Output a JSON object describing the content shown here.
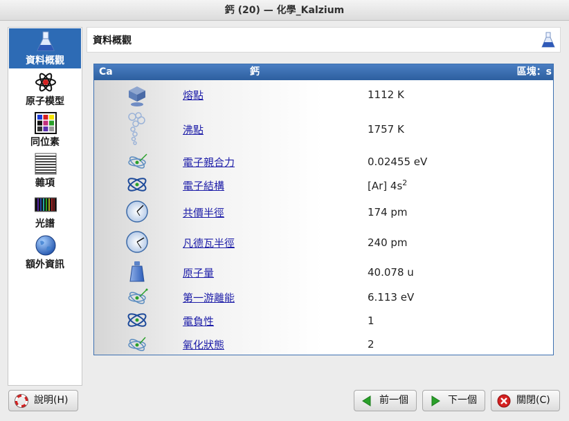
{
  "window": {
    "title": "鈣 (20)  — 化學_Kalzium"
  },
  "sidebar": {
    "items": [
      {
        "label": "資料概觀",
        "icon": "flask-icon",
        "active": true
      },
      {
        "label": "原子模型",
        "icon": "atom-icon",
        "active": false
      },
      {
        "label": "同位素",
        "icon": "isotope-grid-icon",
        "active": false
      },
      {
        "label": "雜項",
        "icon": "misc-lines-icon",
        "active": false
      },
      {
        "label": "光譜",
        "icon": "spectrum-icon",
        "active": false
      },
      {
        "label": "額外資訊",
        "icon": "globe-icon",
        "active": false
      }
    ]
  },
  "header": {
    "title": "資料概觀"
  },
  "panel": {
    "symbol": "Ca",
    "name": "鈣",
    "block": "區塊：s",
    "rows": [
      {
        "label": "熔點",
        "value": "1112 K",
        "icon": "melting-point-icon"
      },
      {
        "label": "沸點",
        "value": "1757 K",
        "icon": "boiling-point-icon"
      },
      {
        "label": "電子親合力",
        "value": "0.02455 eV",
        "icon": "electron-affinity-icon"
      },
      {
        "label": "電子結構",
        "value": "[Ar] 4s",
        "value_sup": "2",
        "icon": "electron-configuration-icon"
      },
      {
        "label": "共價半徑",
        "value": "174 pm",
        "icon": "covalent-radius-icon"
      },
      {
        "label": "凡德瓦半徑",
        "value": "240 pm",
        "icon": "van-der-waals-radius-icon"
      },
      {
        "label": "原子量",
        "value": "40.078 u",
        "icon": "atomic-mass-icon"
      },
      {
        "label": "第一游離能",
        "value": "6.113 eV",
        "icon": "ionization-energy-icon"
      },
      {
        "label": "電負性",
        "value": "1",
        "icon": "electronegativity-icon"
      },
      {
        "label": "氧化狀態",
        "value": "2",
        "icon": "oxidation-states-icon"
      }
    ]
  },
  "buttons": {
    "help": "說明(H)",
    "prev": "前一個",
    "next": "下一個",
    "close": "關閉(C)"
  },
  "colors": {
    "accent": "#2d6bb5",
    "header_bar": "#3a6eb0",
    "link": "#1d1da8"
  }
}
